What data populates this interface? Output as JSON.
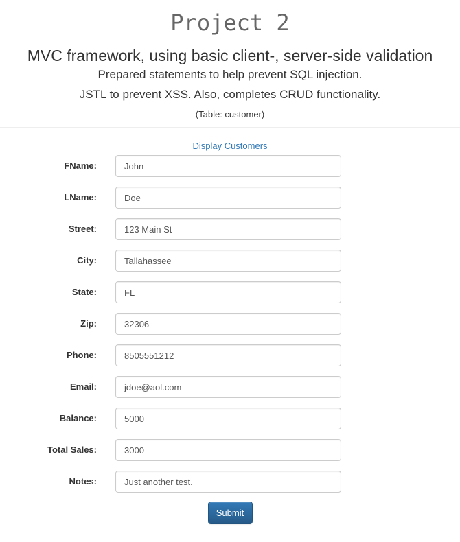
{
  "header": {
    "title": "Project 2",
    "subtitle": "MVC framework, using basic client-, server-side validation",
    "line1": "Prepared statements to help prevent SQL injection.",
    "line2": "JSTL to prevent XSS. Also, completes CRUD functionality.",
    "line3": "(Table: customer)"
  },
  "nav": {
    "display_link": "Display Customers"
  },
  "form": {
    "fields": [
      {
        "label": "FName:",
        "value": "John"
      },
      {
        "label": "LName:",
        "value": "Doe"
      },
      {
        "label": "Street:",
        "value": "123 Main St"
      },
      {
        "label": "City:",
        "value": "Tallahassee"
      },
      {
        "label": "State:",
        "value": "FL"
      },
      {
        "label": "Zip:",
        "value": "32306"
      },
      {
        "label": "Phone:",
        "value": "8505551212"
      },
      {
        "label": "Email:",
        "value": "jdoe@aol.com"
      },
      {
        "label": "Balance:",
        "value": "5000"
      },
      {
        "label": "Total Sales:",
        "value": "3000"
      },
      {
        "label": "Notes:",
        "value": "Just another test."
      }
    ],
    "submit_label": "Submit"
  },
  "colors": {
    "link": "#337ab7",
    "button": "#337ab7",
    "title": "#666666"
  }
}
